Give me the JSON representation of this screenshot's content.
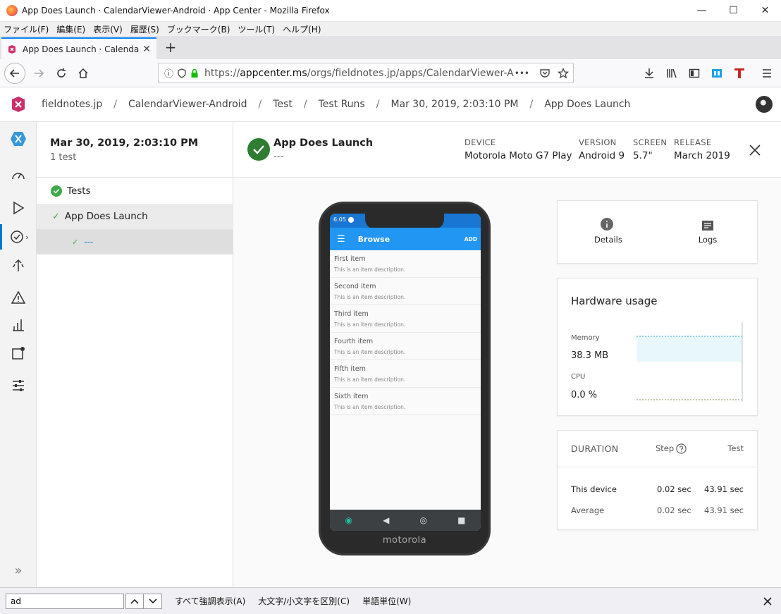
{
  "window": {
    "title": "App Does Launch · CalendarViewer-Android · App Center - Mozilla Firefox",
    "min_glyph": "—",
    "max_glyph": "☐",
    "close_glyph": "✕"
  },
  "menubar": [
    "ファイル(F)",
    "編集(E)",
    "表示(V)",
    "履歴(S)",
    "ブックマーク(B)",
    "ツール(T)",
    "ヘルプ(H)"
  ],
  "tab": {
    "label": "App Does Launch · CalendarVie",
    "close_glyph": "✕",
    "new_glyph": "+"
  },
  "nav": {
    "url_prefix": "https://",
    "url_host": "appcenter.ms",
    "url_path": "/orgs/fieldnotes.jp/apps/CalendarViewer-And",
    "more_glyph": "•••"
  },
  "breadcrumb": {
    "separator": "/",
    "items": [
      "fieldnotes.jp",
      "CalendarViewer-Android",
      "Test",
      "Test Runs",
      "Mar 30, 2019, 2:03:10 PM",
      "App Does Launch"
    ]
  },
  "run": {
    "title": "Mar 30, 2019, 2:03:10 PM",
    "subtitle": "1 test",
    "tree": [
      {
        "label": "Tests"
      },
      {
        "label": "App Does Launch"
      },
      {
        "label": "---"
      }
    ]
  },
  "detail": {
    "title": "App Does Launch",
    "subtitle": "---",
    "meta": [
      {
        "label": "DEVICE",
        "value": "Motorola Moto G7 Play"
      },
      {
        "label": "VERSION",
        "value": "Android 9"
      },
      {
        "label": "SCREEN",
        "value": "5.7\""
      },
      {
        "label": "RELEASE",
        "value": "March 2019"
      }
    ]
  },
  "phone": {
    "time": "6:05",
    "appbar_title": "Browse",
    "appbar_action": "ADD",
    "brand": "motorola",
    "items": [
      {
        "title": "First item",
        "desc": "This is an item description."
      },
      {
        "title": "Second item",
        "desc": "This is an item description."
      },
      {
        "title": "Third item",
        "desc": "This is an item description."
      },
      {
        "title": "Fourth item",
        "desc": "This is an item description."
      },
      {
        "title": "Fifth item",
        "desc": "This is an item description."
      },
      {
        "title": "Sixth item",
        "desc": "This is an item description."
      }
    ]
  },
  "actions": {
    "details": "Details",
    "logs": "Logs"
  },
  "hardware": {
    "title": "Hardware usage",
    "memory_label": "Memory",
    "memory_value": "38.3 MB",
    "cpu_label": "CPU",
    "cpu_value": "0.0 %"
  },
  "duration": {
    "header": "DURATION",
    "col_step": "Step",
    "col_test": "Test",
    "rows": [
      {
        "label": "This device",
        "step": "0.02 sec",
        "test": "43.91 sec"
      },
      {
        "label": "Average",
        "step": "0.02 sec",
        "test": "43.91 sec"
      }
    ]
  },
  "findbar": {
    "query": "ad",
    "highlight_all": "すべて強調表示(A)",
    "match_case": "大文字/小文字を区別(C)",
    "whole_words": "単語単位(W)"
  },
  "colors": {
    "success": "#2e7d32",
    "accent": "#0078d4",
    "phone_bar": "#2196f3"
  }
}
